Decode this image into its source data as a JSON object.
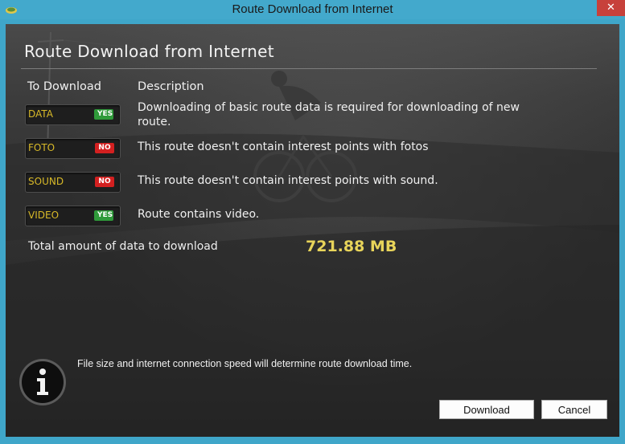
{
  "window": {
    "title": "Route Download from Internet",
    "close_glyph": "✕"
  },
  "dialog": {
    "title": "Route Download from Internet",
    "columns": {
      "to_download": "To Download",
      "description": "Description"
    },
    "items": [
      {
        "label": "DATA",
        "status": "YES",
        "description": "Downloading of basic route data is required for downloading of new route."
      },
      {
        "label": "FOTO",
        "status": "NO",
        "description": "This route doesn't contain interest points with fotos"
      },
      {
        "label": "SOUND",
        "status": "NO",
        "description": "This route doesn't contain interest points with sound."
      },
      {
        "label": "VIDEO",
        "status": "YES",
        "description": "Route contains video."
      }
    ],
    "total": {
      "label": "Total amount of data to download",
      "value": "721.88 MB"
    },
    "info": {
      "icon": "info-icon",
      "text": "File size and internet connection speed will determine route download time."
    },
    "buttons": {
      "download": "Download",
      "cancel": "Cancel"
    }
  },
  "colors": {
    "titlebar": "#43a9cc",
    "close_button": "#c7413b",
    "label_gold": "#d8b928",
    "yes_green": "#2f9a3a",
    "no_red": "#d32020",
    "total_value": "#e8d45a"
  }
}
